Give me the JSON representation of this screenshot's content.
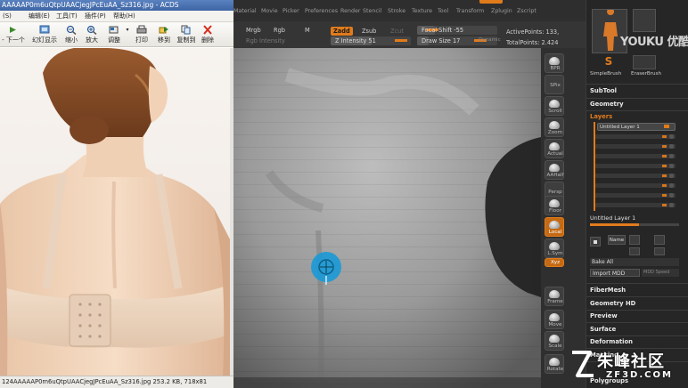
{
  "acdsee": {
    "title": "AAAAAP0m6uQtpUAACjegJPcEuAA_Sz316.jpg - ACDS",
    "menu": [
      "(S)",
      "编辑(E)",
      "工具(T)",
      "插件(P)",
      "帮助(H)"
    ],
    "toolbar": [
      {
        "label": "- 下一个",
        "icon": "next-icon"
      },
      {
        "label": "幻灯显示",
        "icon": "slideshow-icon"
      },
      {
        "label": "缩小",
        "icon": "zoom-out-icon"
      },
      {
        "label": "放大",
        "icon": "zoom-in-icon"
      },
      {
        "label": "调整",
        "icon": "adjust-icon"
      },
      {
        "label": "打印",
        "icon": "print-icon"
      },
      {
        "label": "移到",
        "icon": "move-to-icon"
      },
      {
        "label": "复制到",
        "icon": "copy-to-icon"
      },
      {
        "label": "删除",
        "icon": "delete-icon"
      }
    ],
    "status": "124AAAAAP0m6uQtpUAACjegJPcEuAA_Sz316.jpg     253.2 KB,  718x81"
  },
  "zbrush": {
    "menu": [
      "Material",
      "Movie",
      "Picker",
      "Preferences",
      "Render",
      "Stencil",
      "Stroke",
      "Texture",
      "Tool",
      "Transform",
      "Zplugin",
      "Zscript"
    ],
    "top": {
      "mrgb": "Mrgb",
      "rgb": "Rgb",
      "m": "M",
      "zadd": "Zadd",
      "zsub": "Zsub",
      "zcut": "Zcut",
      "rgb_intensity": "Rgb Intensity",
      "z_intensity": "Z Intensity 51",
      "focal_shift": "Focal Shift -55",
      "draw_size": "Draw Size 17",
      "dynamic": "Dynamic",
      "active_points": "ActivePoints: 133,",
      "total_points": "TotalPoints: 2.424"
    },
    "shelf": [
      "BPR",
      "SPix",
      "Scroll",
      "Zoom",
      "Actual",
      "AAHalf",
      "Persp",
      "Floor",
      "Local",
      "L.Sym",
      "Xyz",
      "Frame",
      "Move",
      "Scale",
      "Rotate"
    ],
    "tray": {
      "top_labels": [
        "SimpleBrush",
        "EraserBrush"
      ],
      "subtool": "SubTool",
      "geometry": "Geometry",
      "layers": "Layers",
      "layer_name_top": "Untitled Layer 1",
      "layer_name_bottom": "Untitled Layer 1",
      "name_button": "Name",
      "bake_all": "Bake All",
      "import_mdd": "Import MDD",
      "mdd_speed": "MDD Speed",
      "sections": [
        "FiberMesh",
        "Geometry HD",
        "Preview",
        "Surface",
        "Deformation",
        "Masking",
        "Polygroups"
      ]
    }
  },
  "watermarks": {
    "youku": "YOUKU 优酷",
    "site_cn": "朱峰社区",
    "site_url": "ZF3D.COM"
  },
  "colors": {
    "zbrush_orange": "#e07b1c",
    "brush_cursor": "#1a9ad6",
    "acdsee_title": "#3e64a3"
  }
}
